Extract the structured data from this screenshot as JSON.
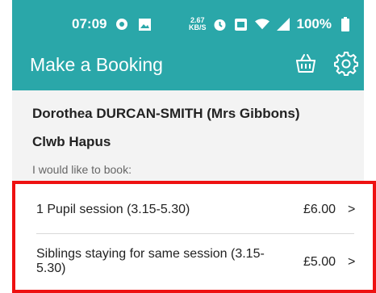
{
  "status_bar": {
    "time": "07:09",
    "speed_value": "2.67",
    "speed_unit": "KB/S",
    "battery": "100%",
    "icons": [
      "chrome-icon",
      "image-icon",
      "alarm-icon",
      "volte-icon",
      "wifi-icon",
      "signal-icon",
      "battery-icon"
    ]
  },
  "app_bar": {
    "title": "Make a Booking",
    "basket_icon": "basket-icon",
    "settings_icon": "gear-icon"
  },
  "booking": {
    "person": "Dorothea DURCAN-SMITH (Mrs Gibbons)",
    "club": "Clwb Hapus",
    "prompt": "I would like to book:",
    "items": [
      {
        "label": "1 Pupil session (3.15-5.30)",
        "price": "£6.00",
        "chevron": ">"
      },
      {
        "label": "Siblings  staying for same session (3.15-5.30)",
        "price": "£5.00",
        "chevron": ">"
      }
    ]
  },
  "colors": {
    "primary": "#2aa7a9",
    "highlight_border": "#ee1111",
    "background": "#f3f3f3"
  }
}
